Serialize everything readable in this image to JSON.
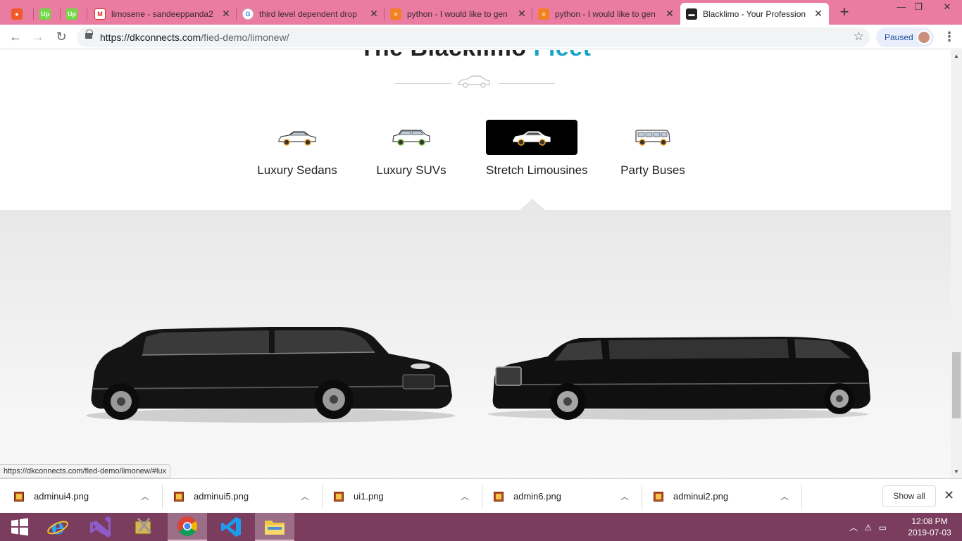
{
  "browser": {
    "tabs": [
      {
        "title": "",
        "favicon": "app-icon",
        "color": "#f05a28"
      },
      {
        "title": "",
        "favicon": "upwork-icon",
        "color": "#6fda44",
        "badge": "Up"
      },
      {
        "title": "",
        "favicon": "upwork-icon",
        "color": "#6fda44",
        "badge": "Up"
      },
      {
        "title": "limosene - sandeeppanda2",
        "favicon": "gmail-icon",
        "color": "#d93025"
      },
      {
        "title": "third level dependent drop",
        "favicon": "google-icon",
        "color": "#4285f4"
      },
      {
        "title": "python - I would like to gen",
        "favicon": "stackoverflow-icon",
        "color": "#f48024"
      },
      {
        "title": "python - I would like to gen",
        "favicon": "stackoverflow-icon",
        "color": "#f48024"
      },
      {
        "title": "Blacklimo - Your Profession",
        "favicon": "limo-icon",
        "color": "#222222"
      }
    ],
    "url_host": "https://dkconnects.com",
    "url_path": "/fied-demo/limonew/",
    "profile_status": "Paused"
  },
  "page": {
    "title_part1": "The Blacklimo",
    "title_part2": "Fleet",
    "categories": [
      {
        "label": "Luxury Sedans",
        "icon": "sedan-icon",
        "active": false
      },
      {
        "label": "Luxury SUVs",
        "icon": "suv-icon",
        "active": false
      },
      {
        "label": "Stretch Limousines",
        "icon": "limo-car-icon",
        "active": true
      },
      {
        "label": "Party Buses",
        "icon": "bus-icon",
        "active": false
      }
    ],
    "accent_color": "#1aa3c9",
    "status_url": "https://dkconnects.com/fied-demo/limonew/#lux"
  },
  "downloads": {
    "items": [
      "adminui4.png",
      "adminui5.png",
      "ui1.png",
      "admin6.png",
      "adminui2.png"
    ],
    "show_all": "Show all"
  },
  "taskbar": {
    "apps": [
      "windows-start-icon",
      "internet-explorer-icon",
      "visual-studio-icon",
      "tools-icon",
      "chrome-icon",
      "vscode-icon",
      "file-explorer-icon"
    ],
    "time": "12:08 PM",
    "date": "2019-07-03"
  }
}
